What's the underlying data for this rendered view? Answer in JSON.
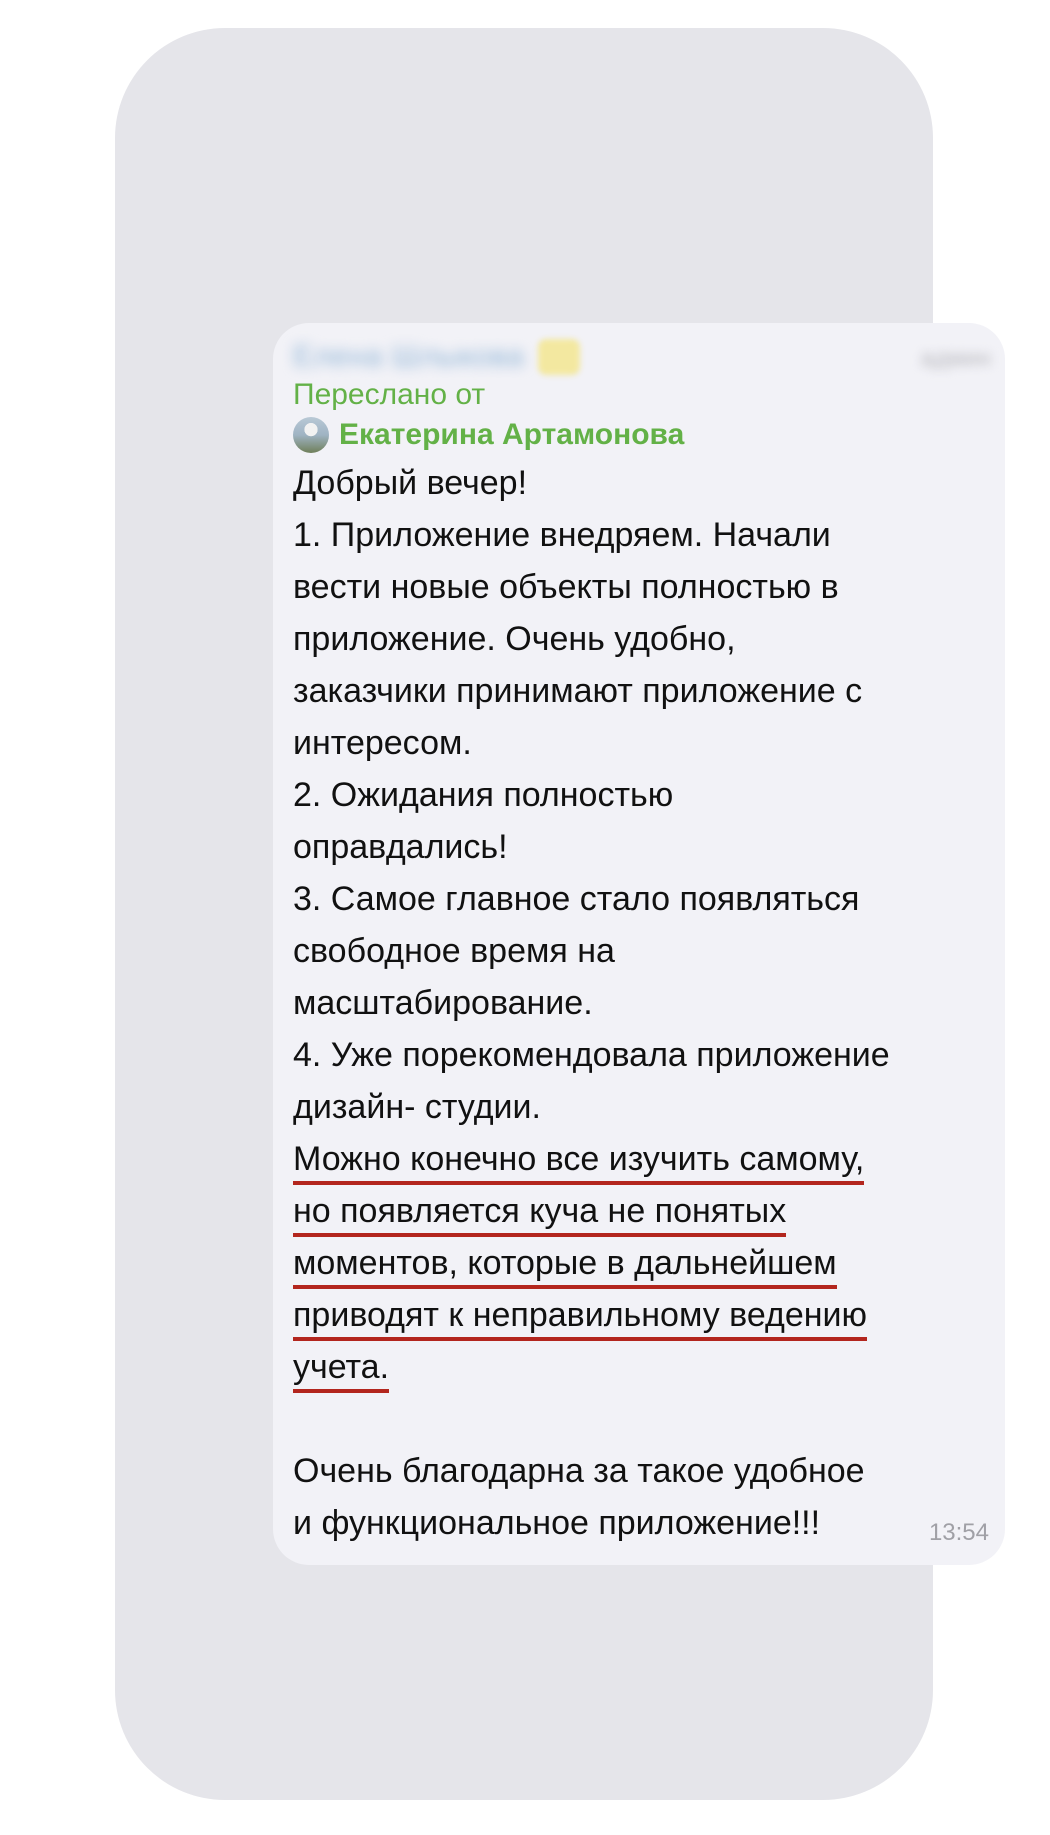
{
  "message": {
    "sender_name": "Елена Шлыкова",
    "sender_role": "админ",
    "forwarded_label": "Переслано от",
    "forwarded_from": "Екатерина Артамонова",
    "lines": [
      "Добрый вечер!",
      "1. Приложение внедряем. Начали",
      "вести новые  объекты полностью в",
      "приложение. Очень удобно,",
      "заказчики принимают приложение с",
      "интересом.",
      "2.  Ожидания полностью",
      "оправдались!",
      "3.  Самое главное стало появляться",
      "свободное время на",
      "масштабирование.",
      "4. Уже порекомендовала приложение",
      "дизайн- студии."
    ],
    "underlined_lines": [
      "Можно конечно все изучить самому,",
      "но появляется куча не понятых",
      "моментов, которые в дальнейшем",
      "приводят к неправильному ведению",
      "учета."
    ],
    "closing_lines": [
      "Очень благодарна за такое удобное",
      "и функциональное приложение!!!"
    ],
    "time": "13:54"
  },
  "colors": {
    "frame_bg": "#e5e5ea",
    "bubble_bg": "#f2f2f7",
    "forward_green": "#63b147",
    "underline_red": "#b3261e",
    "text": "#111111",
    "time_gray": "#a0a0a6"
  },
  "icons": {
    "avatar": "forwarder-avatar"
  }
}
